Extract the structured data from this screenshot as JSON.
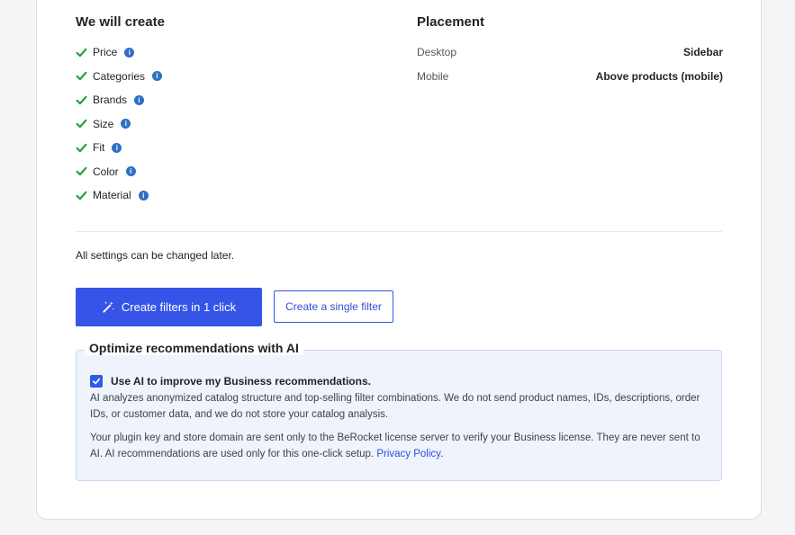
{
  "create": {
    "title": "We will create",
    "items": [
      {
        "label": "Price"
      },
      {
        "label": "Categories"
      },
      {
        "label": "Brands"
      },
      {
        "label": "Size"
      },
      {
        "label": "Fit"
      },
      {
        "label": "Color"
      },
      {
        "label": "Material"
      }
    ]
  },
  "placement": {
    "title": "Placement",
    "rows": [
      {
        "key": "Desktop",
        "value": "Sidebar"
      },
      {
        "key": "Mobile",
        "value": "Above products (mobile)"
      }
    ]
  },
  "note": "All settings can be changed later.",
  "buttons": {
    "primary": "Create filters in 1 click",
    "secondary": "Create a single filter"
  },
  "ai": {
    "legend": "Optimize recommendations with AI",
    "checkbox_label": "Use AI to improve my Business recommendations.",
    "checked": true,
    "paragraph1": "AI analyzes anonymized catalog structure and top-selling filter combinations. We do not send product names, IDs, descriptions, order IDs, or customer data, and we do not store your catalog analysis.",
    "paragraph2": "Your plugin key and store domain are sent only to the BeRocket license server to verify your Business license. They are never sent to AI. AI recommendations are used only for this one-click setup.",
    "link_label": "Privacy Policy",
    "trailing": "."
  },
  "icons": {
    "check": "check-icon",
    "info": "info-icon",
    "wand": "magic-wand-icon"
  },
  "colors": {
    "accent": "#3655e8",
    "check": "#1a9e3a",
    "info": "#2f6fc6"
  }
}
